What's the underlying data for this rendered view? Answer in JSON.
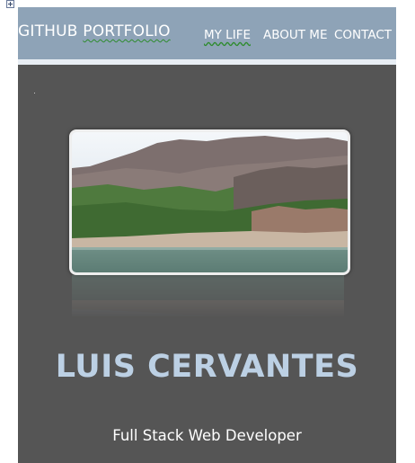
{
  "header": {
    "brand_part1": "GITHUB ",
    "brand_part2": "PORTFOLIO",
    "nav": {
      "my_life": "MY LIFE",
      "about_me": "ABOUT ME",
      "contact": "CONTACT"
    }
  },
  "hero": {
    "name": "LUIS CERVANTES",
    "role": "Full Stack Web Developer"
  },
  "colors": {
    "header_bg": "#8ea3b7",
    "page_bg": "#555555",
    "name_color": "#bcd0e4"
  }
}
